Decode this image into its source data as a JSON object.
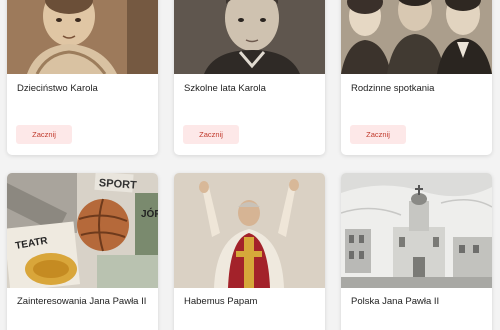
{
  "cards": [
    {
      "title": "Dzieciństwo Karola",
      "button": "Zacznij"
    },
    {
      "title": "Szkolne lata Karola",
      "button": "Zacznij"
    },
    {
      "title": "Rodzinne spotkania",
      "button": "Zacznij"
    },
    {
      "title": "Zainteresowania Jana Pawła II",
      "image_text": [
        "SPORT",
        "TEATR",
        "JÓR"
      ]
    },
    {
      "title": "Habemus Papam"
    },
    {
      "title": "Polska Jana Pawła II"
    }
  ],
  "colors": {
    "button_bg": "#fde8e8",
    "button_text": "#c0392b",
    "sepia_dark": "#5a4330",
    "sepia_light": "#b89a7a"
  }
}
